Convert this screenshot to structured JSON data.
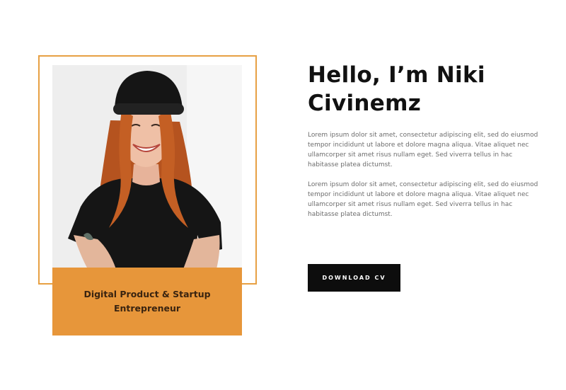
{
  "profile": {
    "caption": "Digital Product & Startup Entrepreneur"
  },
  "intro": {
    "heading": "Hello, I’m Niki Civinemz",
    "paragraphs": [
      "Lorem ipsum dolor sit amet, consectetur adipiscing elit, sed do eiusmod tempor incididunt ut labore et dolore magna aliqua. Vitae aliquet nec ullamcorper sit amet risus nullam eget. Sed viverra tellus in hac habitasse platea dictumst.",
      "Lorem ipsum dolor sit amet, consectetur adipiscing elit, sed do eiusmod tempor incididunt ut labore et dolore magna aliqua. Vitae aliquet nec ullamcorper sit amet risus nullam eget. Sed viverra tellus in hac habitasse platea dictumst."
    ],
    "cta_label": "DOWNLOAD CV"
  },
  "colors": {
    "accent": "#e7963a",
    "frame": "#e7a043",
    "button_bg": "#0d0d0d",
    "heading": "#111111",
    "body_text": "#6c6c6c"
  }
}
